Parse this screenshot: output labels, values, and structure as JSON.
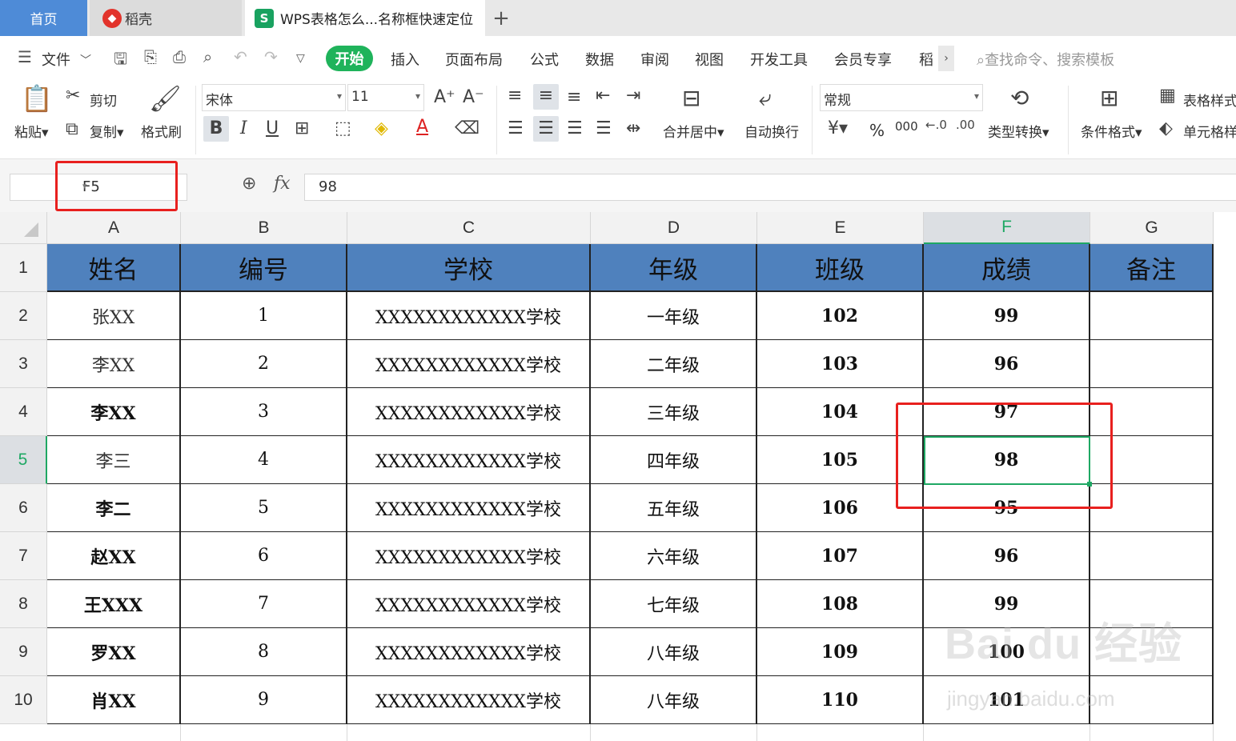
{
  "tabs": {
    "home": "首页",
    "daoke": "稻壳",
    "doc": "WPS表格怎么...名称框快速定位",
    "add": "+"
  },
  "menu": {
    "file": "文件",
    "items": [
      "开始",
      "插入",
      "页面布局",
      "公式",
      "数据",
      "审阅",
      "视图",
      "开发工具",
      "会员专享",
      "稻"
    ],
    "search": "查找命令、搜索模板"
  },
  "ribbon": {
    "paste": "粘贴",
    "cut": "剪切",
    "copy": "复制",
    "format_painter": "格式刷",
    "font_name": "宋体",
    "font_size": "11",
    "merge_center": "合并居中",
    "wrap": "自动换行",
    "number_format": "常规",
    "convert": "类型转换",
    "cond_format": "条件格式",
    "table_style": "表格样式",
    "cell_style": "单元格样式",
    "percent": "%",
    "thousands": "000"
  },
  "formula_bar": {
    "name_box": "F5",
    "fx": "fx",
    "value": "98"
  },
  "columns": [
    "A",
    "B",
    "C",
    "D",
    "E",
    "F",
    "G"
  ],
  "rows": [
    "1",
    "2",
    "3",
    "4",
    "5",
    "6",
    "7",
    "8",
    "9",
    "10"
  ],
  "table": {
    "headers": [
      "姓名",
      "编号",
      "学校",
      "年级",
      "班级",
      "成绩",
      "备注"
    ],
    "data": [
      [
        "张XX",
        "1",
        "XXXXXXXXXXXX学校",
        "一年级",
        "102",
        "99",
        ""
      ],
      [
        "李XX",
        "2",
        "XXXXXXXXXXXX学校",
        "二年级",
        "103",
        "96",
        ""
      ],
      [
        "李XX",
        "3",
        "XXXXXXXXXXXX学校",
        "三年级",
        "104",
        "97",
        ""
      ],
      [
        "李三",
        "4",
        "XXXXXXXXXXXX学校",
        "四年级",
        "105",
        "98",
        ""
      ],
      [
        "李二",
        "5",
        "XXXXXXXXXXXX学校",
        "五年级",
        "106",
        "95",
        ""
      ],
      [
        "赵XX",
        "6",
        "XXXXXXXXXXXX学校",
        "六年级",
        "107",
        "96",
        ""
      ],
      [
        "王XXX",
        "7",
        "XXXXXXXXXXXX学校",
        "七年级",
        "108",
        "99",
        ""
      ],
      [
        "罗XX",
        "8",
        "XXXXXXXXXXXX学校",
        "八年级",
        "109",
        "100",
        ""
      ],
      [
        "肖XX",
        "9",
        "XXXXXXXXXXXX学校",
        "八年级",
        "110",
        "101",
        ""
      ]
    ]
  },
  "selected_cell": "F5",
  "colors": {
    "accent": "#1fb35b",
    "header_fill": "#4f81bd",
    "highlight_box": "#e8201e",
    "home_tab": "#4e8bd7"
  },
  "watermark": {
    "main": "Bai du 经验",
    "sub": "jingyan.baidu.com"
  }
}
